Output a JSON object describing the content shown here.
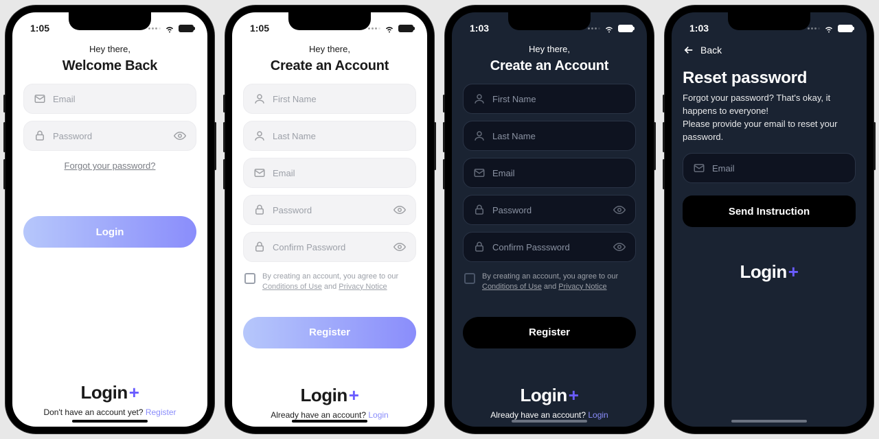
{
  "status": {
    "time_light": "1:05",
    "time_dark": "1:03"
  },
  "common": {
    "greeting": "Hey there,",
    "logo_text": "Login",
    "logo_plus": "+"
  },
  "login": {
    "title": "Welcome Back",
    "email_ph": "Email",
    "password_ph": "Password",
    "forgot": "Forgot your password?",
    "btn": "Login",
    "footer_q": "Don't have an account yet? ",
    "footer_link": "Register"
  },
  "register": {
    "title": "Create an Account",
    "first_ph": "First Name",
    "last_ph": "Last Name",
    "email_ph": "Email",
    "password_ph": "Password",
    "confirm_ph": "Confirm Password",
    "confirm_ph_dark": "Confirm Passsword",
    "terms_lead": "By creating an account, you agree to our ",
    "terms_cond": "Conditions of Use",
    "terms_and": " and ",
    "terms_priv": "Privacy Notice",
    "btn": "Register",
    "footer_q": "Already have an account? ",
    "footer_link": "Login"
  },
  "reset": {
    "back": "Back",
    "title": "Reset password",
    "desc1": "Forgot your password? That's okay, it happens to everyone!",
    "desc2": "Please provide your email to reset your password.",
    "email_ph": "Email",
    "btn": "Send Instruction"
  }
}
